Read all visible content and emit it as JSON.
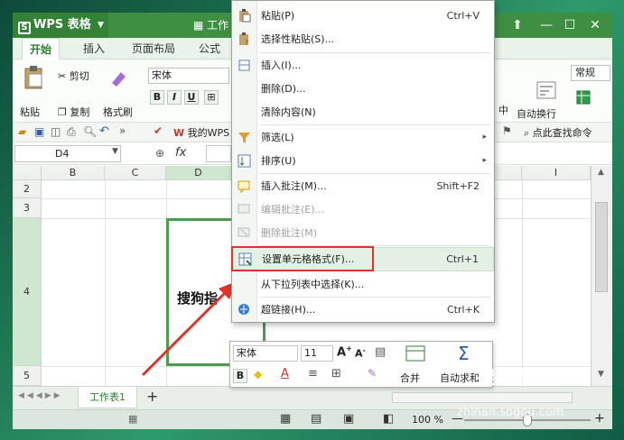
{
  "app": {
    "brand": "WPS 表格",
    "doc_title": "工作",
    "window_controls": [
      "restore-icon",
      "minimize-icon",
      "maximize-icon",
      "close-icon"
    ]
  },
  "ribbon_tabs": [
    "开始",
    "插入",
    "页面布局",
    "公式"
  ],
  "ribbon": {
    "paste_label": "粘贴",
    "cut_label": "剪切",
    "copy_label": "复制",
    "format_painter_label": "格式刷",
    "font_name": "宋体",
    "bold_label": "B",
    "italic_label": "I",
    "underline_label": "U",
    "wrap_text_label": "自动换行",
    "number_format": "常规",
    "right_text": "中"
  },
  "quick_bar": {
    "my_wps_label": "我的WPS",
    "find_label": "点此查找命令"
  },
  "formula_bar": {
    "cell_ref": "D4",
    "fx_label": "fx"
  },
  "grid": {
    "columns": [
      "B",
      "C",
      "D",
      "I"
    ],
    "rows": [
      "2",
      "3",
      "4",
      "5"
    ],
    "cell_text": "搜狗指"
  },
  "sheet_tabs": [
    "工作表1"
  ],
  "status_bar": {
    "zoom": "100 %",
    "zoom_level": 1.0
  },
  "context_menu": {
    "items": [
      {
        "label": "粘贴(P)",
        "key": "Ctrl+V"
      },
      {
        "label": "选择性粘贴(S)...",
        "key": ""
      },
      {
        "label": "插入(I)...",
        "key": ""
      },
      {
        "label": "删除(D)...",
        "key": ""
      },
      {
        "label": "清除内容(N)",
        "key": ""
      },
      {
        "label": "筛选(L)",
        "key": ""
      },
      {
        "label": "排序(U)",
        "key": ""
      },
      {
        "label": "插入批注(M)...",
        "key": "Shift+F2"
      },
      {
        "label": "编辑批注(E)...",
        "key": ""
      },
      {
        "label": "删除批注(M)",
        "key": ""
      },
      {
        "label": "设置单元格格式(F)...",
        "key": "Ctrl+1"
      },
      {
        "label": "从下拉列表中选择(K)...",
        "key": ""
      },
      {
        "label": "超链接(H)...",
        "key": "Ctrl+K"
      }
    ]
  },
  "mini_toolbar": {
    "font_name": "宋体",
    "font_size": "11",
    "merge_label": "合并",
    "autosum_label": "自动求和",
    "bold_label": "B"
  },
  "watermark": {
    "logo_text": "搜狗指南",
    "url": "zhinan.sogou.com"
  },
  "colors": {
    "title_green": "#3f8f43",
    "highlight_red": "#e0342b",
    "selection_green": "#4c9c4c"
  }
}
